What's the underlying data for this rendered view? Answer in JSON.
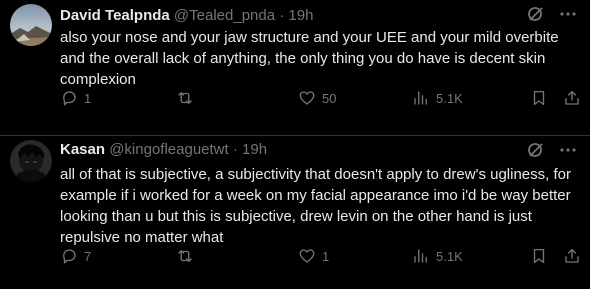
{
  "tweets": [
    {
      "name": "David Tealpnda",
      "handle": "@Tealed_pnda",
      "dot": "·",
      "time": "19h",
      "text": "also your nose and your jaw structure and your UEE and your mild overbite and the overall lack of anything, the only thing you do have is decent skin complexion",
      "replies": "1",
      "retweets": "",
      "likes": "50",
      "views": "5.1K",
      "avatar_icon": "landscape-avatar-icon"
    },
    {
      "name": "Kasan",
      "handle": "@kingofleaguetwt",
      "dot": "·",
      "time": "19h",
      "text": "all of that is subjective, a subjectivity that doesn't apply to drew's ugliness, for example if i worked for a week on my facial appearance imo i'd be way better looking than u but this is subjective, drew levin on the other hand is just repulsive no matter what",
      "replies": "7",
      "retweets": "",
      "likes": "1",
      "views": "5.1K",
      "avatar_icon": "dark-figure-avatar-icon"
    }
  ],
  "colors": {
    "background": "#000000",
    "text": "#e7e9ea",
    "secondary": "#71767b",
    "divider": "#2f3336"
  }
}
